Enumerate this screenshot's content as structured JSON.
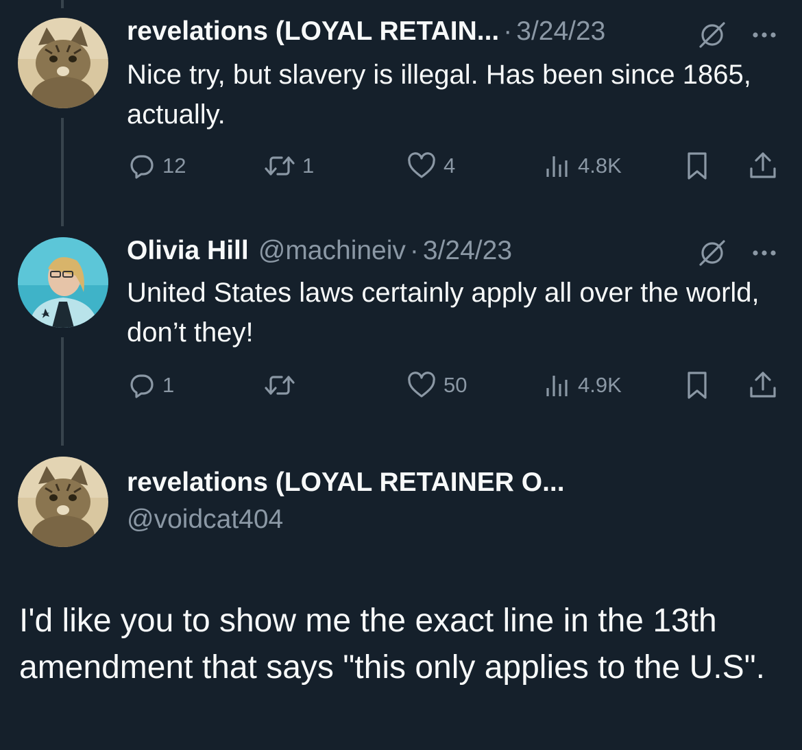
{
  "tweets": [
    {
      "author_name": "revelations (LOYAL RETAIN...",
      "separator": "·",
      "date": "3/24/23",
      "text": "Nice try, but slavery is illegal. Has been since 1865, actually.",
      "replies": "12",
      "retweets": "1",
      "likes": "4",
      "views": "4.8K"
    },
    {
      "author_name": "Olivia Hill",
      "handle": "@machineiv",
      "separator": "·",
      "date": "3/24/23",
      "text": "United States laws certainly apply all over the world, don’t they!",
      "replies": "1",
      "retweets": "",
      "likes": "50",
      "views": "4.9K"
    }
  ],
  "focused": {
    "author_name": "revelations (LOYAL RETAINER O...",
    "handle": "@voidcat404",
    "text": "I'd like you to show me the exact line in the 13th amendment that says \"this only applies to the U.S\"."
  },
  "icons": {
    "reply": "reply-icon",
    "retweet": "retweet-icon",
    "like": "like-icon",
    "views": "views-icon",
    "bookmark": "bookmark-icon",
    "share": "share-icon",
    "grok": "grok-icon",
    "more": "more-icon"
  },
  "colors": {
    "background": "#15202b",
    "text": "#f7f9f9",
    "muted": "#8b98a5",
    "thread_line": "#38444d"
  }
}
